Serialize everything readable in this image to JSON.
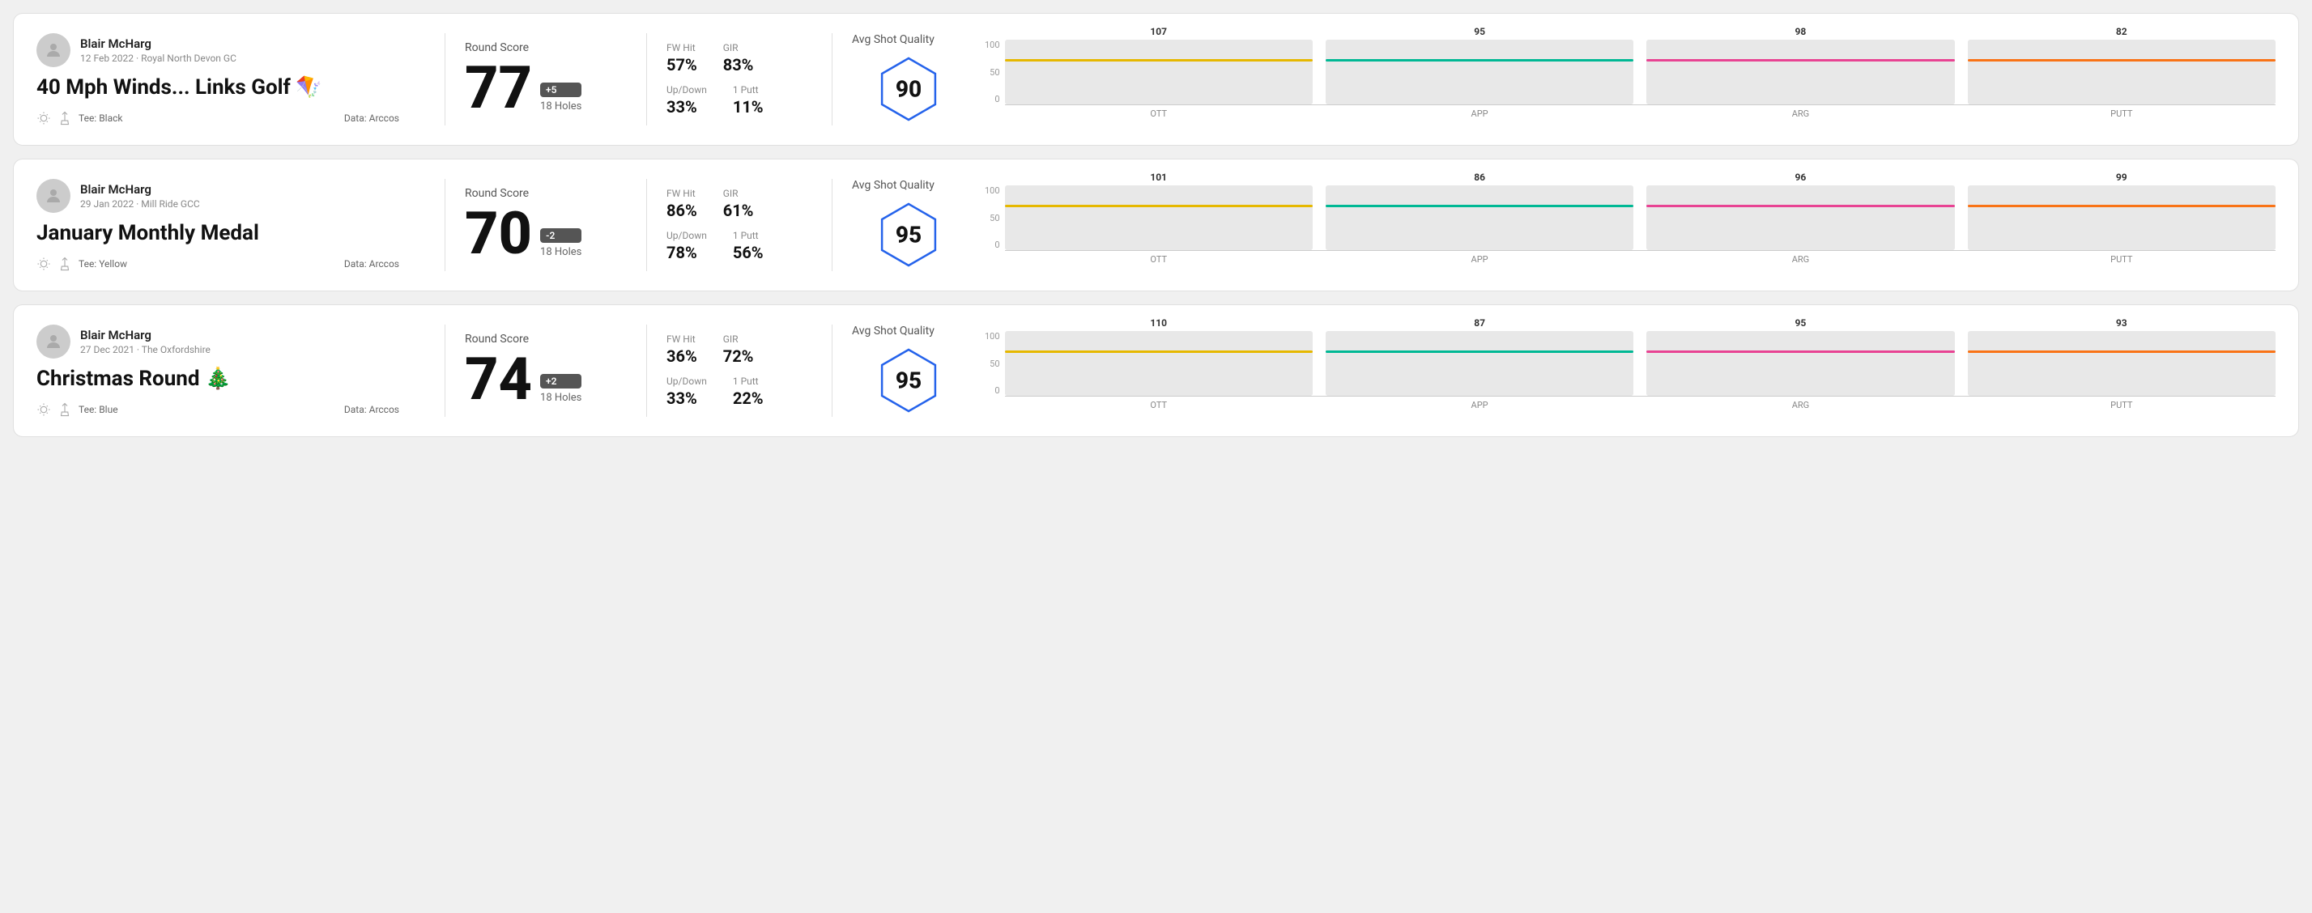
{
  "rounds": [
    {
      "id": "round1",
      "player_name": "Blair McHarg",
      "date_course": "12 Feb 2022 · Royal North Devon GC",
      "title": "40 Mph Winds... Links Golf 🪁",
      "tee": "Black",
      "data_source": "Data: Arccos",
      "round_score_label": "Round Score",
      "score": "77",
      "score_diff": "+5",
      "holes": "18 Holes",
      "fw_hit_label": "FW Hit",
      "fw_hit": "57%",
      "gir_label": "GIR",
      "gir": "83%",
      "updown_label": "Up/Down",
      "updown": "33%",
      "oneputt_label": "1 Putt",
      "oneputt": "11%",
      "avg_quality_label": "Avg Shot Quality",
      "quality_score": "90",
      "chart": {
        "bars": [
          {
            "label": "OTT",
            "value": 107,
            "color": "#e6b800",
            "max": 150
          },
          {
            "label": "APP",
            "value": 95,
            "color": "#00b894",
            "max": 150
          },
          {
            "label": "ARG",
            "value": 98,
            "color": "#e84393",
            "max": 150
          },
          {
            "label": "PUTT",
            "value": 82,
            "color": "#f97316",
            "max": 150
          }
        ]
      }
    },
    {
      "id": "round2",
      "player_name": "Blair McHarg",
      "date_course": "29 Jan 2022 · Mill Ride GCC",
      "title": "January Monthly Medal",
      "tee": "Yellow",
      "data_source": "Data: Arccos",
      "round_score_label": "Round Score",
      "score": "70",
      "score_diff": "-2",
      "holes": "18 Holes",
      "fw_hit_label": "FW Hit",
      "fw_hit": "86%",
      "gir_label": "GIR",
      "gir": "61%",
      "updown_label": "Up/Down",
      "updown": "78%",
      "oneputt_label": "1 Putt",
      "oneputt": "56%",
      "avg_quality_label": "Avg Shot Quality",
      "quality_score": "95",
      "chart": {
        "bars": [
          {
            "label": "OTT",
            "value": 101,
            "color": "#e6b800",
            "max": 150
          },
          {
            "label": "APP",
            "value": 86,
            "color": "#00b894",
            "max": 150
          },
          {
            "label": "ARG",
            "value": 96,
            "color": "#e84393",
            "max": 150
          },
          {
            "label": "PUTT",
            "value": 99,
            "color": "#f97316",
            "max": 150
          }
        ]
      }
    },
    {
      "id": "round3",
      "player_name": "Blair McHarg",
      "date_course": "27 Dec 2021 · The Oxfordshire",
      "title": "Christmas Round 🎄",
      "tee": "Blue",
      "data_source": "Data: Arccos",
      "round_score_label": "Round Score",
      "score": "74",
      "score_diff": "+2",
      "holes": "18 Holes",
      "fw_hit_label": "FW Hit",
      "fw_hit": "36%",
      "gir_label": "GIR",
      "gir": "72%",
      "updown_label": "Up/Down",
      "updown": "33%",
      "oneputt_label": "1 Putt",
      "oneputt": "22%",
      "avg_quality_label": "Avg Shot Quality",
      "quality_score": "95",
      "chart": {
        "bars": [
          {
            "label": "OTT",
            "value": 110,
            "color": "#e6b800",
            "max": 150
          },
          {
            "label": "APP",
            "value": 87,
            "color": "#00b894",
            "max": 150
          },
          {
            "label": "ARG",
            "value": 95,
            "color": "#e84393",
            "max": 150
          },
          {
            "label": "PUTT",
            "value": 93,
            "color": "#f97316",
            "max": 150
          }
        ]
      }
    }
  ],
  "y_axis_labels": [
    "100",
    "50",
    "0"
  ]
}
